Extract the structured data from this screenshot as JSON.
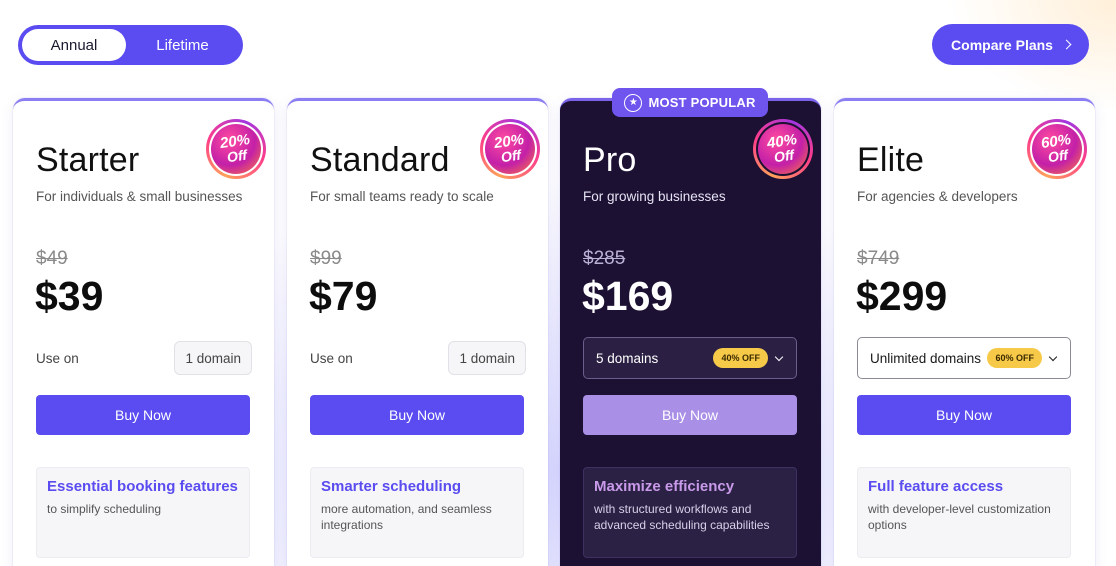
{
  "billing_toggle": {
    "annual": "Annual",
    "lifetime": "Lifetime"
  },
  "compare_label": "Compare Plans",
  "popular_label": "MOST POPULAR",
  "colors": {
    "accent": "#5a4cf0",
    "dark_card": "#1c1033",
    "pill": "#f7c948"
  },
  "plans": [
    {
      "name": "Starter",
      "description": "For individuals & small businesses",
      "discount_pct": "20%",
      "discount_off": "Off",
      "old_price": "$49",
      "price": "$39",
      "use_on": "Use on",
      "domain": "1 domain",
      "buy": "Buy Now",
      "feature_title": "Essential booking features",
      "feature_sub": "to simplify scheduling"
    },
    {
      "name": "Standard",
      "description": "For small teams ready to scale",
      "discount_pct": "20%",
      "discount_off": "Off",
      "old_price": "$99",
      "price": "$79",
      "use_on": "Use on",
      "domain": "1 domain",
      "buy": "Buy Now",
      "feature_title": "Smarter scheduling",
      "feature_sub": "more automation, and seamless integrations"
    },
    {
      "name": "Pro",
      "description": "For growing businesses",
      "discount_pct": "40%",
      "discount_off": "Off",
      "old_price": "$285",
      "price": "$169",
      "domain": "5 domains",
      "domain_pill": "40% OFF",
      "buy": "Buy Now",
      "feature_title": "Maximize efficiency",
      "feature_sub": "with structured workflows and advanced scheduling capabilities"
    },
    {
      "name": "Elite",
      "description": "For agencies & developers",
      "discount_pct": "60%",
      "discount_off": "Off",
      "old_price": "$749",
      "price": "$299",
      "domain": "Unlimited domains",
      "domain_pill": "60% OFF",
      "buy": "Buy Now",
      "feature_title": "Full feature access",
      "feature_sub": "with developer-level customization options"
    }
  ]
}
